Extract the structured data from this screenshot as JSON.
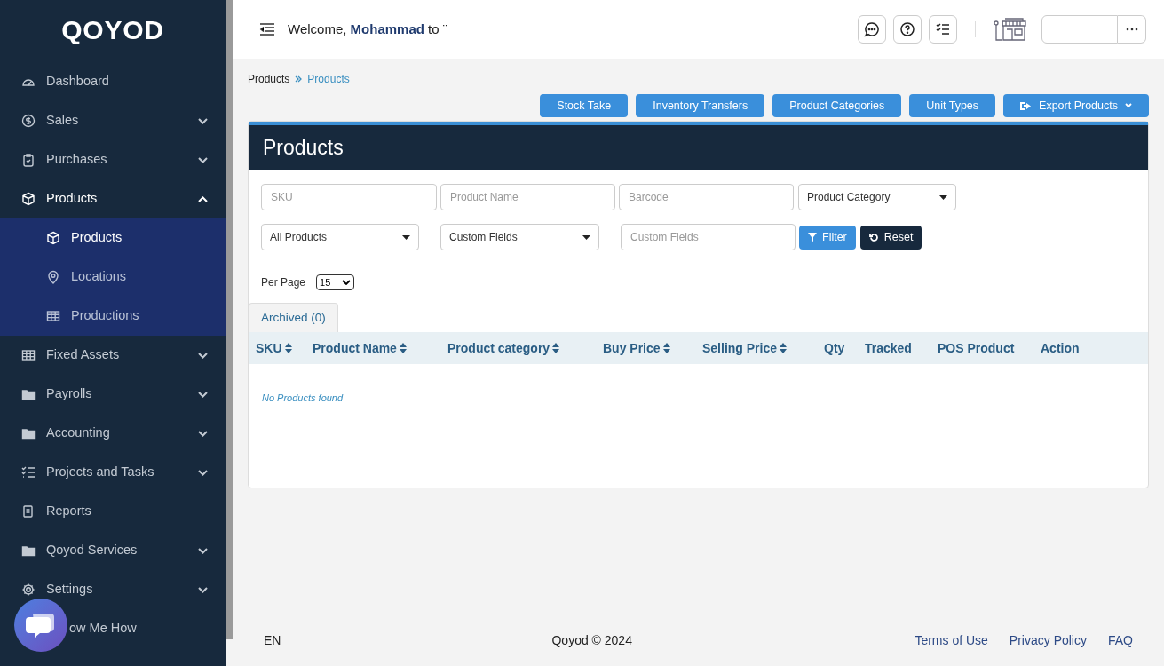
{
  "sidebar": {
    "logo": "QOYOD",
    "items": [
      {
        "label": "Dashboard"
      },
      {
        "label": "Sales",
        "expanded": false
      },
      {
        "label": "Purchases",
        "expanded": false
      },
      {
        "label": "Products",
        "expanded": true,
        "children": [
          {
            "label": "Products",
            "selected": true
          },
          {
            "label": "Locations",
            "selected": false
          },
          {
            "label": "Productions",
            "selected": false
          }
        ]
      },
      {
        "label": "Fixed Assets",
        "expanded": false
      },
      {
        "label": "Payrolls",
        "expanded": false
      },
      {
        "label": "Accounting",
        "expanded": false
      },
      {
        "label": "Projects and Tasks",
        "expanded": false
      },
      {
        "label": "Reports"
      },
      {
        "label": "Qoyod Services",
        "expanded": false
      },
      {
        "label": "Settings",
        "expanded": false
      },
      {
        "label": "ow Me How"
      }
    ]
  },
  "header": {
    "welcome": "Welcome, **Mohammad** to ¨"
  },
  "breadcrumb": [
    "Products",
    "Products"
  ],
  "actions": [
    {
      "label": "Stock Take"
    },
    {
      "label": "Inventory Transfers"
    },
    {
      "label": "Product Categories"
    },
    {
      "label": "Unit Types"
    },
    {
      "label": "Export Products",
      "dropdown": true
    }
  ],
  "panel": {
    "title": "Products",
    "filters": [
      {
        "kind": "input",
        "placeholder": "SKU"
      },
      {
        "kind": "input",
        "placeholder": "Product Name"
      },
      {
        "kind": "input",
        "placeholder": "Barcode"
      },
      {
        "kind": "select",
        "value": "Product Category"
      },
      {
        "kind": "select",
        "value": "All Products"
      },
      {
        "kind": "select",
        "value": "Custom Fields"
      },
      {
        "kind": "input",
        "placeholder": "Custom Fields"
      }
    ],
    "filter_button": "Filter",
    "reset_button": "Reset",
    "per_page": {
      "label": "Per Page",
      "value": "15"
    },
    "tabs": [
      {
        "label": "Archived (0)",
        "selected": true
      }
    ],
    "columns": [
      {
        "label": "SKU",
        "sortable": true
      },
      {
        "label": "Product Name",
        "sortable": true
      },
      {
        "label": "Product category",
        "sortable": true
      },
      {
        "label": "Buy Price",
        "sortable": true
      },
      {
        "label": "Selling Price",
        "sortable": true
      },
      {
        "label": "Qty",
        "sortable": false
      },
      {
        "label": "Tracked",
        "sortable": false
      },
      {
        "label": "POS Product",
        "sortable": false
      },
      {
        "label": "Action",
        "sortable": false
      }
    ],
    "empty": "No Products found"
  },
  "footer": {
    "language": "EN",
    "copyright": "Qoyod © 2024",
    "links": [
      "Terms of Use",
      "Privacy Policy",
      "FAQ"
    ]
  }
}
